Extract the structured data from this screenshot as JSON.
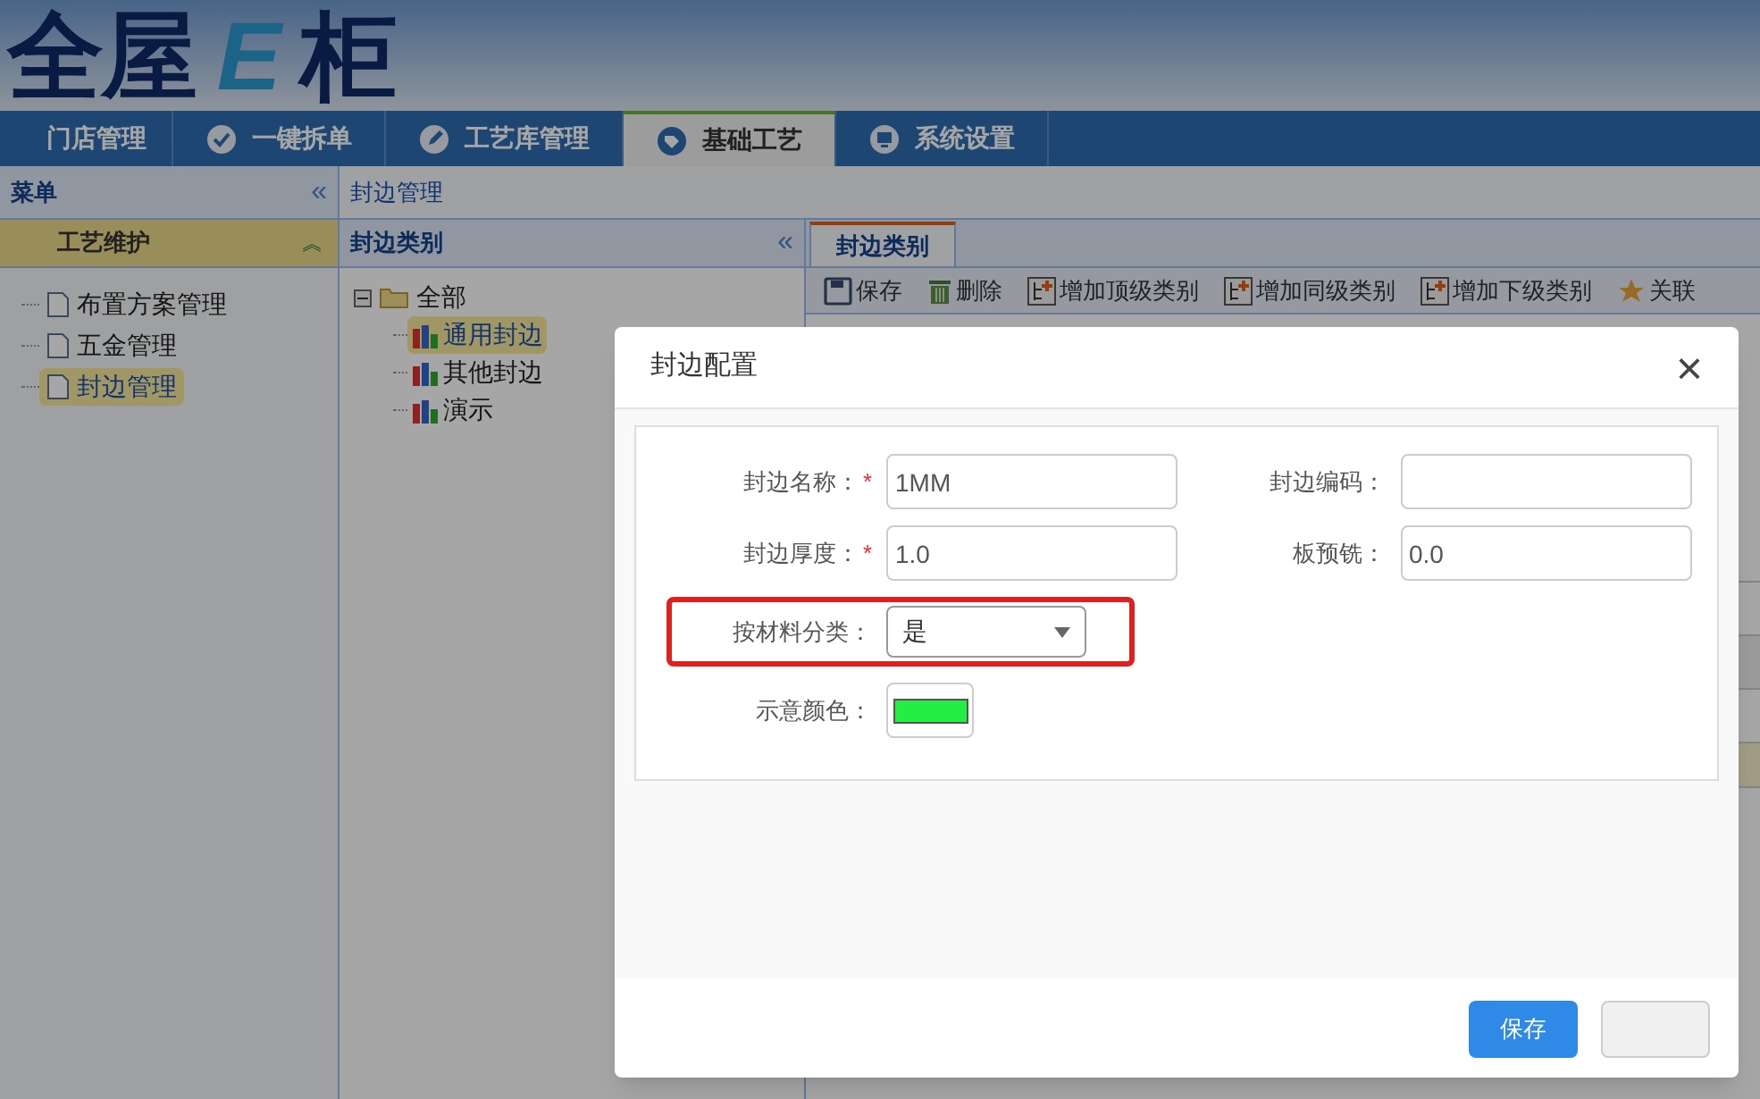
{
  "logo": {
    "parts": [
      "全屋",
      "E",
      "柜"
    ]
  },
  "nav": [
    {
      "label": "门店管理",
      "selected": false
    },
    {
      "label": "一键拆单",
      "selected": false
    },
    {
      "label": "工艺库管理",
      "selected": false
    },
    {
      "label": "基础工艺",
      "selected": true
    },
    {
      "label": "系统设置",
      "selected": false
    }
  ],
  "sidebar": {
    "title": "菜单",
    "collapse": "«",
    "section": "工艺维护",
    "expand": "︽",
    "items": [
      {
        "label": "布置方案管理",
        "selected": false
      },
      {
        "label": "五金管理",
        "selected": false
      },
      {
        "label": "封边管理",
        "selected": true
      }
    ]
  },
  "breadcrumb": "封边管理",
  "category_panel": {
    "title": "封边类别",
    "collapse": "«",
    "root": {
      "label": "全部",
      "expanded": true,
      "children": [
        {
          "label": "通用封边",
          "selected": true
        },
        {
          "label": "其他封边",
          "selected": false
        },
        {
          "label": "演示",
          "selected": false
        }
      ]
    }
  },
  "tabs": [
    {
      "label": "封边类别",
      "selected": true
    }
  ],
  "toolbar": [
    {
      "label": "保存"
    },
    {
      "label": "删除"
    },
    {
      "label": "增加顶级类别"
    },
    {
      "label": "增加同级类别"
    },
    {
      "label": "增加下级类别"
    },
    {
      "label": "关联"
    }
  ],
  "dialog": {
    "title": "封边配置",
    "close": "×",
    "rows": [
      [
        {
          "kind": "text",
          "label": "封边名称：",
          "required_mark": "*",
          "value": "1MM"
        },
        {
          "kind": "text",
          "label": "封边编码："
        }
      ],
      [
        {
          "kind": "text",
          "label": "封边厚度：",
          "required_mark": "*",
          "value": "1.0"
        },
        {
          "kind": "text",
          "label": "板预铣：",
          "value": "0.0"
        }
      ],
      [
        {
          "kind": "select",
          "label": "按材料分类：",
          "value": "是",
          "highlighted": true
        }
      ],
      [
        {
          "kind": "color",
          "label": "示意颜色：",
          "color": "#22ee44"
        }
      ]
    ],
    "buttons": [
      {
        "label": "保存",
        "primary": true
      },
      {
        "primary": false
      }
    ]
  }
}
